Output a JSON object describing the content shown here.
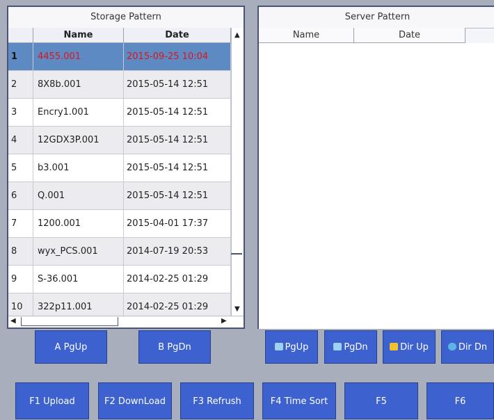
{
  "storage": {
    "title": "Storage Pattern",
    "col_name": "Name",
    "col_date": "Date",
    "rows": [
      {
        "num": "1",
        "name": "4455.001",
        "date": "2015-09-25 10:04"
      },
      {
        "num": "2",
        "name": "8X8b.001",
        "date": "2015-05-14 12:51"
      },
      {
        "num": "3",
        "name": "Encry1.001",
        "date": "2015-05-14 12:51"
      },
      {
        "num": "4",
        "name": "12GDX3P.001",
        "date": "2015-05-14 12:51"
      },
      {
        "num": "5",
        "name": "b3.001",
        "date": "2015-05-14 12:51"
      },
      {
        "num": "6",
        "name": "Q.001",
        "date": "2015-05-14 12:51"
      },
      {
        "num": "7",
        "name": "1200.001",
        "date": "2015-04-01 17:37"
      },
      {
        "num": "8",
        "name": "wyx_PCS.001",
        "date": "2014-07-19 20:53"
      },
      {
        "num": "9",
        "name": "S-36.001",
        "date": "2014-02-25 01:29"
      },
      {
        "num": "10",
        "name": "322p11.001",
        "date": "2014-02-25 01:29"
      }
    ],
    "btn_pgup": "A PgUp",
    "btn_pgdn": "B PgDn"
  },
  "server": {
    "title": "Server Pattern",
    "col_name": "Name",
    "col_date": "Date",
    "btn_pgup": "PgUp",
    "btn_pgdn": "PgDn",
    "btn_dirup": "Dir Up",
    "btn_dirdn": "Dir Dn"
  },
  "fkeys": {
    "f1": "F1 Upload",
    "f2": "F2 DownLoad",
    "f3": "F3 Refrush",
    "f4": "F4 Time Sort",
    "f5": "F5",
    "f6": "F6"
  },
  "colors": {
    "selected_row": "#5d8ac3",
    "selected_text": "#e0131b",
    "button": "#3d62cf"
  },
  "selected_row_index": 0
}
